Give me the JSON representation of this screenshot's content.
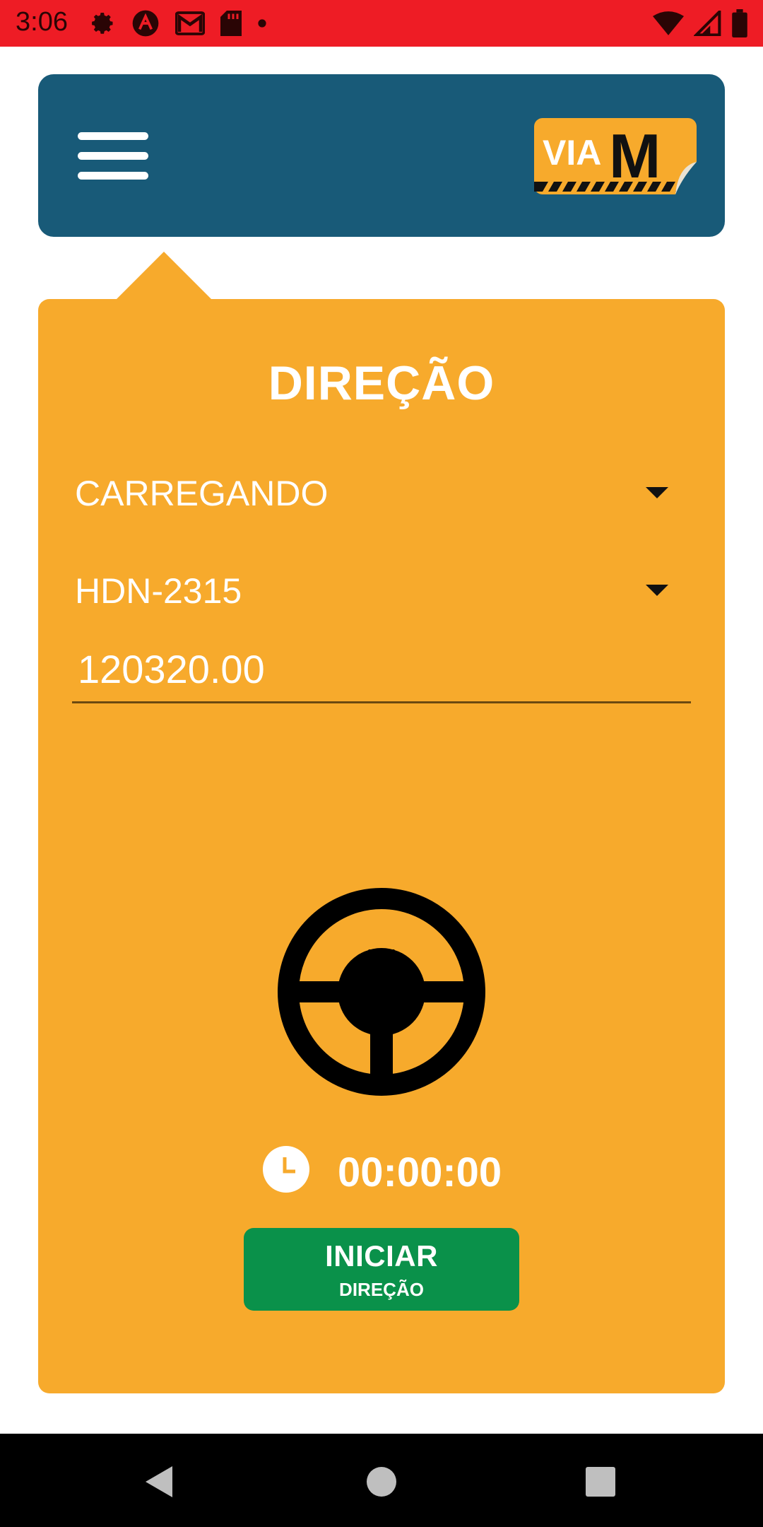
{
  "status_bar": {
    "time": "3:06",
    "background": "#ee1c25",
    "left_icons": [
      "settings-icon",
      "app-logo-icon",
      "gmail-icon",
      "sd-card-icon",
      "dot-icon"
    ],
    "right_icons": [
      "wifi-icon",
      "signal-icon",
      "battery-icon"
    ]
  },
  "header": {
    "background": "#185a78",
    "menu_icon": "hamburger-icon",
    "logo": {
      "text_via": "VIA",
      "text_m": "M",
      "color": "#f7aa2c"
    }
  },
  "card": {
    "background": "#f7aa2c",
    "title": "DIREÇÃO",
    "activity_select": {
      "value": "CARREGANDO"
    },
    "vehicle_select": {
      "value": "HDN-2315"
    },
    "odometer_input": {
      "value": "120320.00"
    },
    "main_icon": "steering-wheel-icon",
    "timer": {
      "icon": "clock-icon",
      "value": "00:00:00"
    },
    "start_button": {
      "label": "INICIAR",
      "sublabel": "DIREÇÃO",
      "color": "#0a914a"
    }
  },
  "nav_bar": {
    "buttons": [
      "back-icon",
      "home-icon",
      "recents-icon"
    ]
  }
}
